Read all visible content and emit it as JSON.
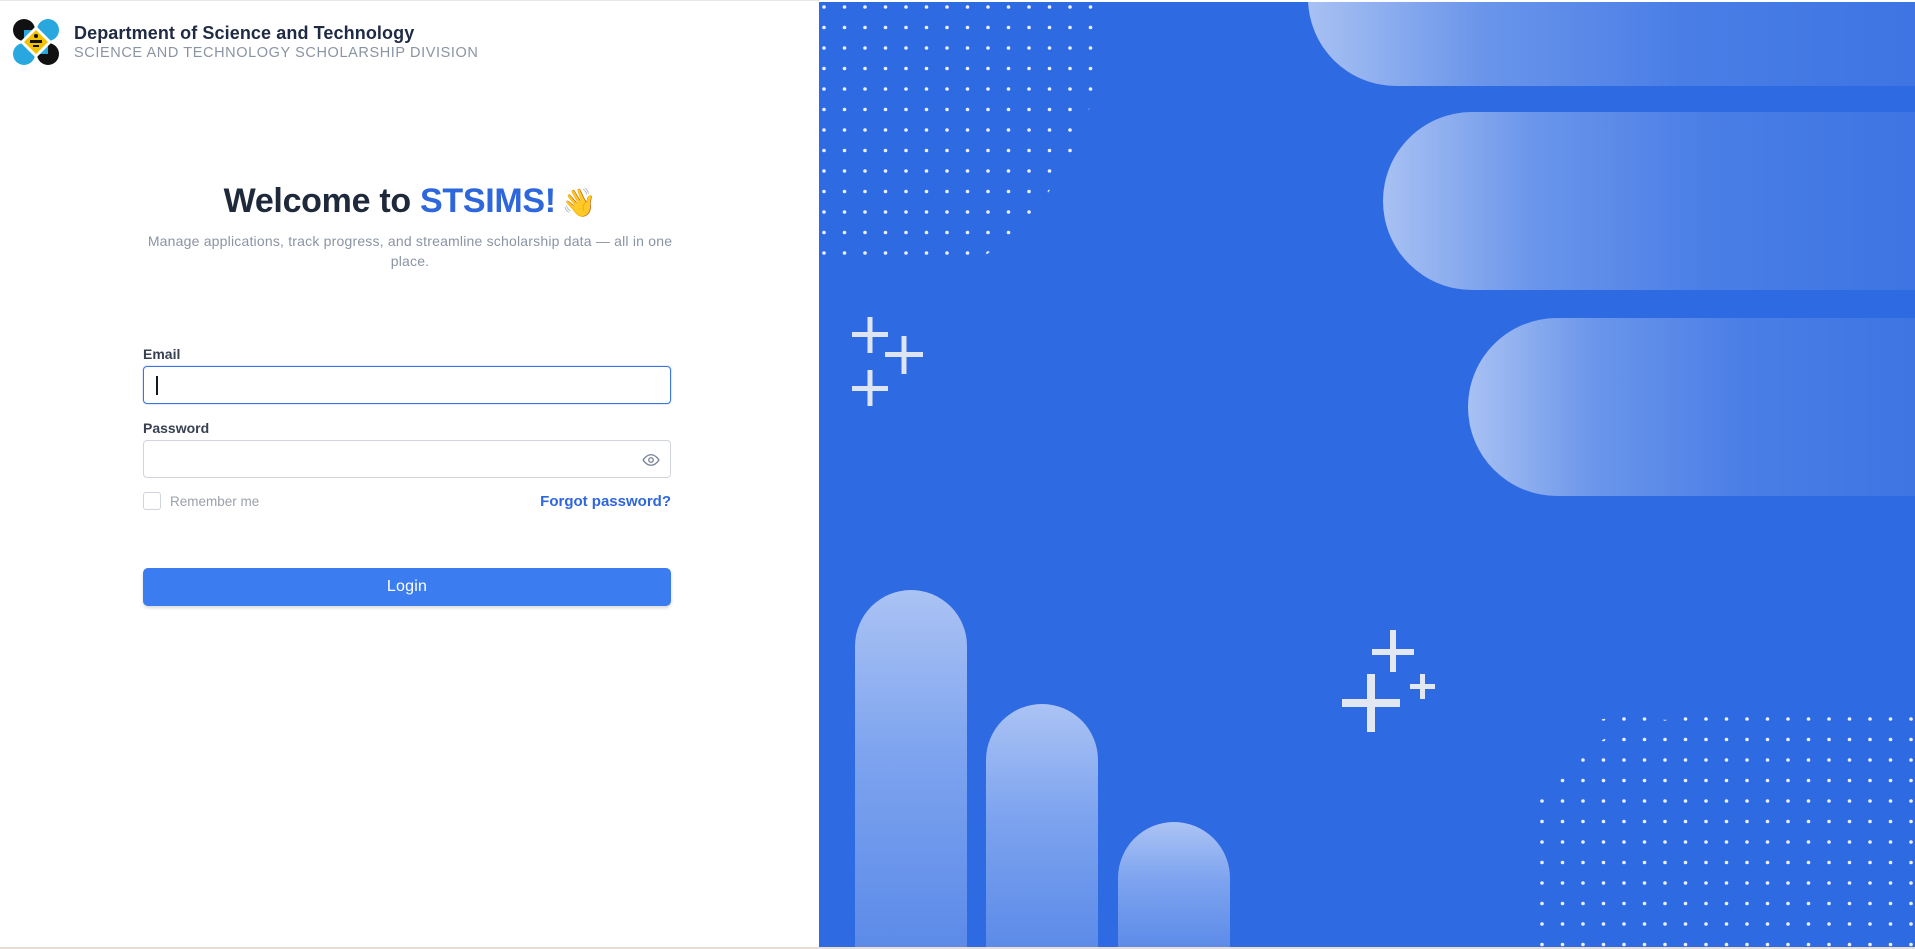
{
  "header": {
    "org_name": "Department of Science and Technology",
    "division_name": "SCIENCE AND TECHNOLOGY SCHOLARSHIP DIVISION",
    "logo_icon": "dost-logo-icon"
  },
  "welcome": {
    "title_prefix": "Welcome to ",
    "title_brand": "STSIMS!",
    "title_emoji": "👋",
    "subtitle": "Manage applications, track progress, and streamline scholarship data — all in one place."
  },
  "form": {
    "email_label": "Email",
    "email_value": "",
    "password_label": "Password",
    "password_value": "",
    "password_toggle_icon": "eye-icon",
    "remember_label": "Remember me",
    "remember_checked": false,
    "forgot_label": "Forgot password?",
    "login_label": "Login"
  },
  "colors": {
    "accent": "#2e66dc",
    "button": "#3b7cf0",
    "panel": "#2e6ae1",
    "heading": "#1e293b",
    "muted": "#8a94a3"
  }
}
